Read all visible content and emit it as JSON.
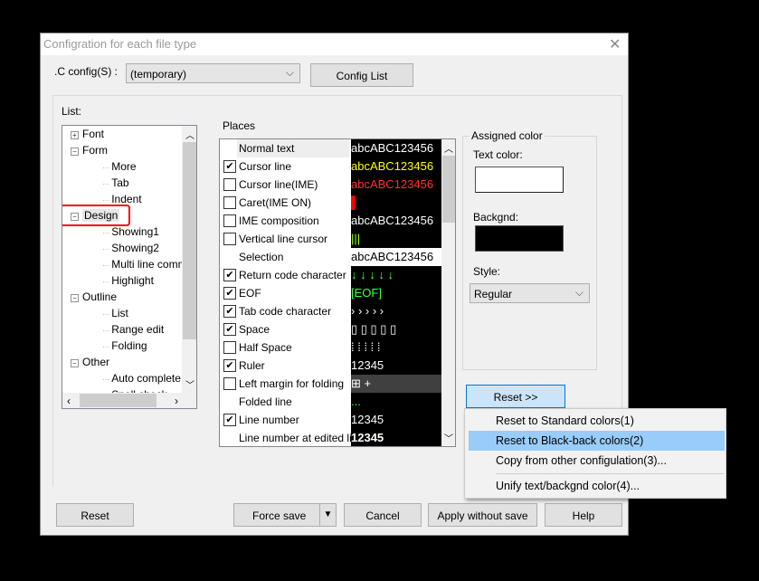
{
  "window": {
    "title": "Configration for each file type",
    "close_icon": "close-icon"
  },
  "config": {
    "label": ".C config(S) :",
    "value": "(temporary)",
    "config_list_button": "Config List"
  },
  "list": {
    "label": "List:",
    "items": [
      {
        "label": "Font",
        "level": 0,
        "expander": "+"
      },
      {
        "label": "Form",
        "level": 0,
        "expander": "-"
      },
      {
        "label": "More",
        "level": 1
      },
      {
        "label": "Tab",
        "level": 1
      },
      {
        "label": "Indent",
        "level": 1
      },
      {
        "label": "Design",
        "level": 0,
        "expander": "-",
        "highlighted": true
      },
      {
        "label": "Showing1",
        "level": 1
      },
      {
        "label": "Showing2",
        "level": 1
      },
      {
        "label": "Multi line comm",
        "level": 1
      },
      {
        "label": "Highlight",
        "level": 1
      },
      {
        "label": "Outline",
        "level": 0,
        "expander": "-"
      },
      {
        "label": "List",
        "level": 1
      },
      {
        "label": "Range edit",
        "level": 1
      },
      {
        "label": "Folding",
        "level": 1
      },
      {
        "label": "Other",
        "level": 0,
        "expander": "-"
      },
      {
        "label": "Auto complete",
        "level": 1
      },
      {
        "label": "Spell check",
        "level": 1
      }
    ],
    "highlight_color": "#ff0000"
  },
  "places": {
    "label": "Places",
    "rows": [
      {
        "label": "Normal text",
        "checkbox": null,
        "preview": "abcABC123456",
        "fg": "#ffffff",
        "bg": "#000000",
        "selected": true
      },
      {
        "label": "Cursor line",
        "checkbox": true,
        "preview": "abcABC123456",
        "fg": "#ffff00",
        "bg": "#000000"
      },
      {
        "label": "Cursor line(IME)",
        "checkbox": false,
        "preview": "abcABC123456",
        "fg": "#ff3030",
        "bg": "#000000"
      },
      {
        "label": "Caret(IME ON)",
        "checkbox": false,
        "preview": "▌",
        "fg": "#ff0000",
        "bg": "#000000"
      },
      {
        "label": "IME composition",
        "checkbox": false,
        "preview": "abcABC123456",
        "fg": "#ffffff",
        "bg": "#000000"
      },
      {
        "label": "Vertical line cursor",
        "checkbox": false,
        "preview": "|||",
        "fg": "#a0ff00",
        "bg": "#000000"
      },
      {
        "label": "Selection",
        "checkbox": null,
        "preview": "abcABC123456",
        "fg": "#000000",
        "bg": "#ffffff"
      },
      {
        "label": "Return code character",
        "checkbox": true,
        "preview": "↓   ↓   ↓   ↓   ↓",
        "fg": "#40ff40",
        "bg": "#000000"
      },
      {
        "label": "EOF",
        "checkbox": true,
        "preview": "[EOF]",
        "fg": "#40ff40",
        "bg": "#000000"
      },
      {
        "label": "Tab code character",
        "checkbox": true,
        "preview": "›     ›     ›     ›     ›",
        "fg": "#ffffff",
        "bg": "#000000"
      },
      {
        "label": "Space",
        "checkbox": true,
        "preview": "▯  ▯  ▯  ▯  ▯",
        "fg": "#ffffff",
        "bg": "#000000"
      },
      {
        "label": "Half Space",
        "checkbox": false,
        "preview": "⁞    ⁞    ⁞    ⁞    ⁞",
        "fg": "#ffffff",
        "bg": "#000000"
      },
      {
        "label": "Ruler",
        "checkbox": true,
        "preview": "12345",
        "fg": "#ffffff",
        "bg": "#000000"
      },
      {
        "label": "Left margin for folding",
        "checkbox": false,
        "preview": "⊞ +",
        "fg": "#ffffff",
        "bg": "#404040"
      },
      {
        "label": "Folded line",
        "checkbox": null,
        "preview": "...",
        "fg": "#40ff40",
        "bg": "#000000"
      },
      {
        "label": "Line number",
        "checkbox": true,
        "preview": "12345",
        "fg": "#ffffff",
        "bg": "#000000"
      },
      {
        "label": "Line number at edited line",
        "checkbox": null,
        "preview": "12345",
        "fg": "#ffffff",
        "bg": "#000000",
        "bold": true
      }
    ]
  },
  "assigned": {
    "label": "Assigned color",
    "text_color_label": "Text color:",
    "text_color": "#ffffff",
    "backgnd_label": "Backgnd:",
    "backgnd_color": "#000000",
    "style_label": "Style:",
    "style_value": "Regular"
  },
  "reset_menu_button": "Reset >>",
  "menu": {
    "items": [
      "Reset to Standard colors(1)",
      "Reset to Black-back colors(2)",
      "Copy from other configulation(3)...",
      "Unify text/backgnd color(4)..."
    ],
    "highlighted_index": 1,
    "highlight_color": "#99ccf8"
  },
  "footer": {
    "reset": "Reset",
    "force_save": "Force save",
    "cancel": "Cancel",
    "apply": "Apply without save",
    "help": "Help"
  }
}
